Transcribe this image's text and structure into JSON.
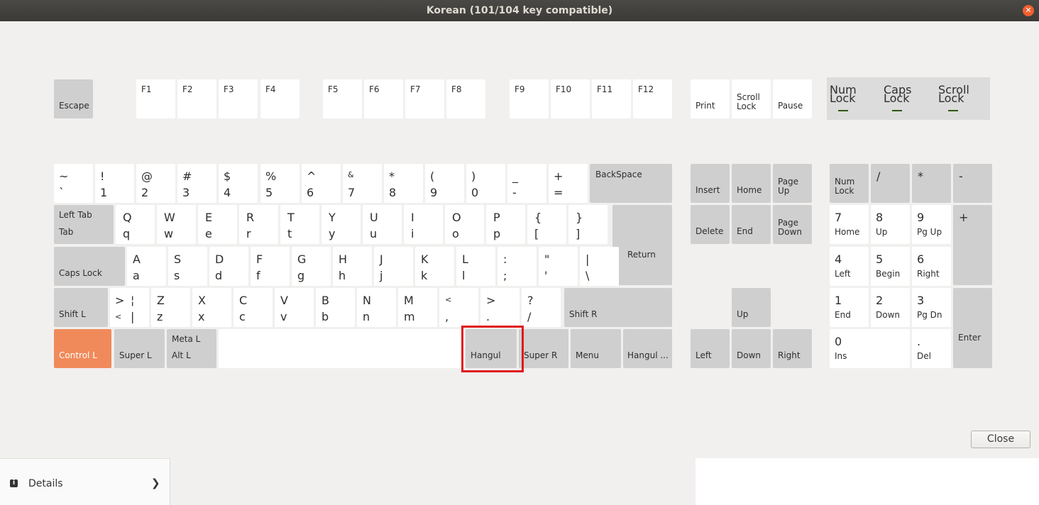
{
  "window": {
    "title": "Korean (101/104 key compatible)"
  },
  "function_row": {
    "escape": "Escape",
    "f": [
      "F1",
      "F2",
      "F3",
      "F4",
      "F5",
      "F6",
      "F7",
      "F8",
      "F9",
      "F10",
      "F11",
      "F12"
    ],
    "print": "Print",
    "scroll_lock": [
      "Scroll",
      "Lock"
    ],
    "pause": "Pause"
  },
  "lock_indicators": [
    [
      "Num",
      "Lock"
    ],
    [
      "Caps",
      "Lock"
    ],
    [
      "Scroll",
      "Lock"
    ]
  ],
  "number_row": [
    [
      "~",
      "`"
    ],
    [
      "!",
      "1"
    ],
    [
      "@",
      "2"
    ],
    [
      "#",
      "3"
    ],
    [
      "$",
      "4"
    ],
    [
      "%",
      "5"
    ],
    [
      "^",
      "6"
    ],
    [
      "&",
      "7"
    ],
    [
      "*",
      "8"
    ],
    [
      "(",
      "9"
    ],
    [
      ")",
      "0"
    ],
    [
      "_",
      "-"
    ],
    [
      "+",
      "="
    ]
  ],
  "backspace": "BackSpace",
  "tab_key": [
    "Left Tab",
    "Tab"
  ],
  "q_row": [
    [
      "Q",
      "q"
    ],
    [
      "W",
      "w"
    ],
    [
      "E",
      "e"
    ],
    [
      "R",
      "r"
    ],
    [
      "T",
      "t"
    ],
    [
      "Y",
      "y"
    ],
    [
      "U",
      "u"
    ],
    [
      "I",
      "i"
    ],
    [
      "O",
      "o"
    ],
    [
      "P",
      "p"
    ],
    [
      "{",
      "["
    ],
    [
      "}",
      "]"
    ]
  ],
  "return": "Return",
  "caps_lock": "Caps Lock",
  "a_row": [
    [
      "A",
      "a"
    ],
    [
      "S",
      "s"
    ],
    [
      "D",
      "d"
    ],
    [
      "F",
      "f"
    ],
    [
      "G",
      "g"
    ],
    [
      "H",
      "h"
    ],
    [
      "J",
      "j"
    ],
    [
      "K",
      "k"
    ],
    [
      "L",
      "l"
    ],
    [
      ":",
      ";"
    ],
    [
      "\"",
      "'"
    ],
    [
      "|",
      "\\"
    ]
  ],
  "shift_l": "Shift L",
  "z_row": [
    [
      ">",
      "<",
      "¦",
      "|"
    ],
    [
      "Z",
      "z"
    ],
    [
      "X",
      "x"
    ],
    [
      "C",
      "c"
    ],
    [
      "V",
      "v"
    ],
    [
      "B",
      "b"
    ],
    [
      "N",
      "n"
    ],
    [
      "M",
      "m"
    ],
    [
      "<",
      ","
    ],
    [
      ">",
      "."
    ],
    [
      "?",
      "/"
    ]
  ],
  "shift_r": "Shift R",
  "bottom_row": {
    "control_l": "Control L",
    "super_l": "Super L",
    "meta_alt": [
      "Meta L",
      "Alt L"
    ],
    "hangul": "Hangul",
    "super_r": "Super R",
    "menu": "Menu",
    "hangul_hanja": "Hangul ..."
  },
  "nav_cluster": {
    "insert": "Insert",
    "home": "Home",
    "page_up": [
      "Page",
      "Up"
    ],
    "delete": "Delete",
    "end": "End",
    "page_down": [
      "Page",
      "Down"
    ],
    "up": "Up",
    "left": "Left",
    "down": "Down",
    "right": "Right"
  },
  "numpad": {
    "num_lock": [
      "Num",
      "Lock"
    ],
    "divide": "/",
    "multiply": "*",
    "minus": "-",
    "plus": "+",
    "keys": [
      [
        "7",
        "Home"
      ],
      [
        "8",
        "Up"
      ],
      [
        "9",
        "Pg Up"
      ],
      [
        "4",
        "Left"
      ],
      [
        "5",
        "Begin"
      ],
      [
        "6",
        "Right"
      ],
      [
        "1",
        "End"
      ],
      [
        "2",
        "Down"
      ],
      [
        "3",
        "Pg Dn"
      ]
    ],
    "ins": [
      "0",
      "Ins"
    ],
    "del": [
      ".",
      "Del"
    ],
    "enter": "Enter"
  },
  "buttons": {
    "close": "Close"
  },
  "details": {
    "label": "Details",
    "info_icon": "info-icon",
    "chevron_icon": "chevron-right-icon"
  },
  "colors": {
    "pressed_key": "#f08a5a",
    "highlight": "#e0191b",
    "lock_indicator": "#2d5a10"
  }
}
